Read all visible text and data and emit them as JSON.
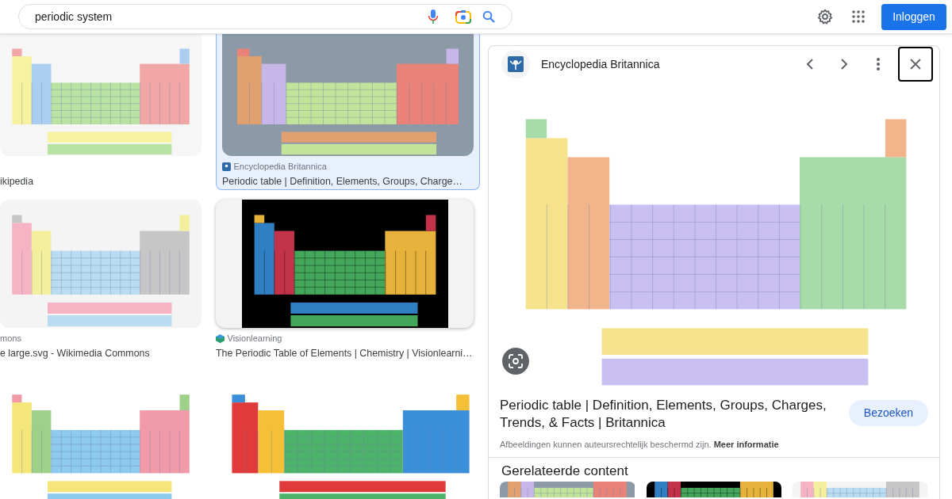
{
  "search": {
    "value": "periodic system"
  },
  "header": {
    "login_button": "Inloggen"
  },
  "results": [
    {
      "title": "ikipedia",
      "selected": false
    },
    {
      "source": "Encyclopedia Britannica",
      "title": "Periodic table | Definition, Elements, Groups, Charge…",
      "selected": true
    },
    {
      "source": "mons",
      "title": "e large.svg - Wikimedia Commons",
      "selected": false
    },
    {
      "source": "Visionlearning",
      "title": "The Periodic Table of Elements | Chemistry | Visionlearni…",
      "selected": false
    },
    {
      "selected": false
    },
    {
      "selected": false
    }
  ],
  "preview": {
    "source": "Encyclopedia Britannica",
    "title": "Periodic table | Definition, Elements, Groups, Charges, Trends, & Facts | Britannica",
    "visit_button": "Bezoeken",
    "notice": "Afbeeldingen kunnen auteursrechtelijk beschermd zijn. **Meer informatie**",
    "related_heading": "Gerelateerde content"
  }
}
